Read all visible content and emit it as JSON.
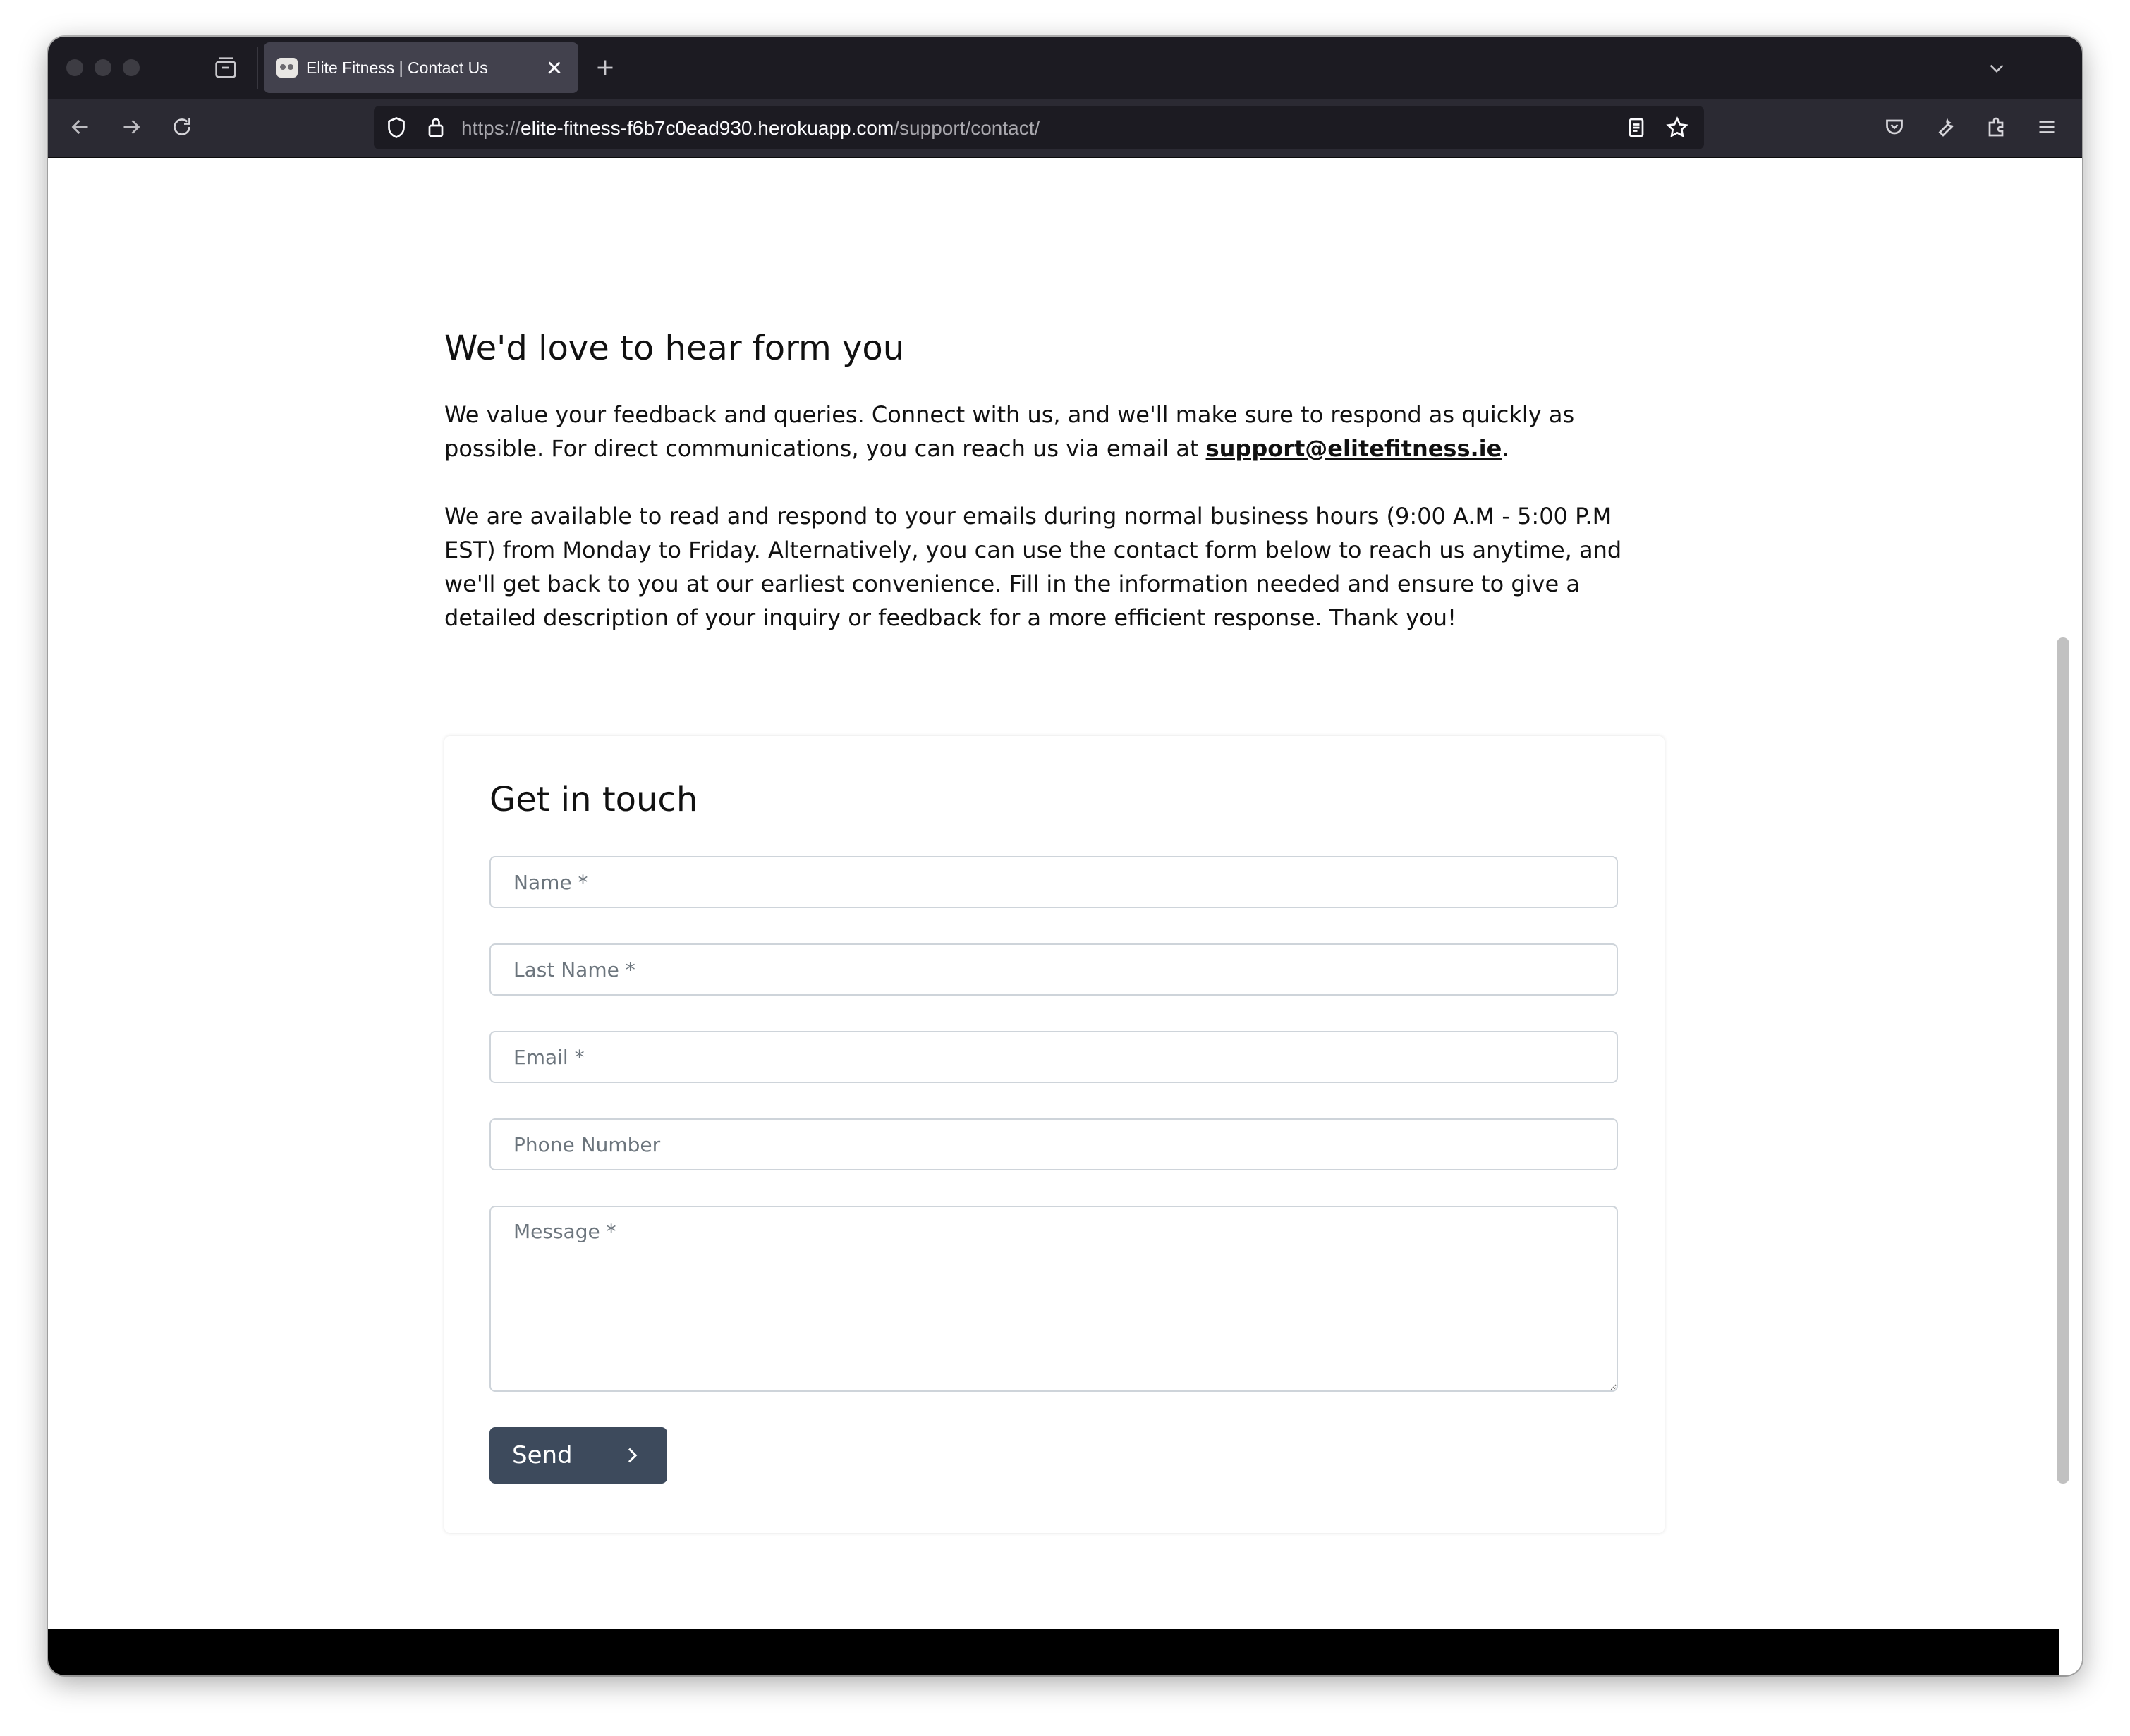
{
  "browser": {
    "tab_title": "Elite Fitness | Contact Us",
    "url_scheme": "https://",
    "url_host": "elite-fitness-f6b7c0ead930.herokuapp.com",
    "url_path": "/support/contact/"
  },
  "intro": {
    "heading": "We'd love to hear form you",
    "para1_before": "We value your feedback and queries. Connect with us, and we'll make sure to respond as quickly as possible. For direct communications, you can reach us via email at ",
    "email": "support@elitefitness.ie",
    "para1_after": ".",
    "para2": "We are available to read and respond to your emails during normal business hours (9:00 A.M - 5:00 P.M EST) from Monday to Friday. Alternatively, you can use the contact form below to reach us anytime, and we'll get back to you at our earliest convenience. Fill in the information needed and ensure to give a detailed description of your inquiry or feedback for a more efficient response. Thank you!"
  },
  "form": {
    "title": "Get in touch",
    "name_placeholder": "Name *",
    "last_name_placeholder": "Last Name *",
    "email_placeholder": "Email *",
    "phone_placeholder": "Phone Number",
    "message_placeholder": "Message *",
    "send_label": "Send"
  },
  "colors": {
    "browser_chrome": "#1c1b22",
    "button": "#3d4a5c",
    "footer": "#000000"
  }
}
